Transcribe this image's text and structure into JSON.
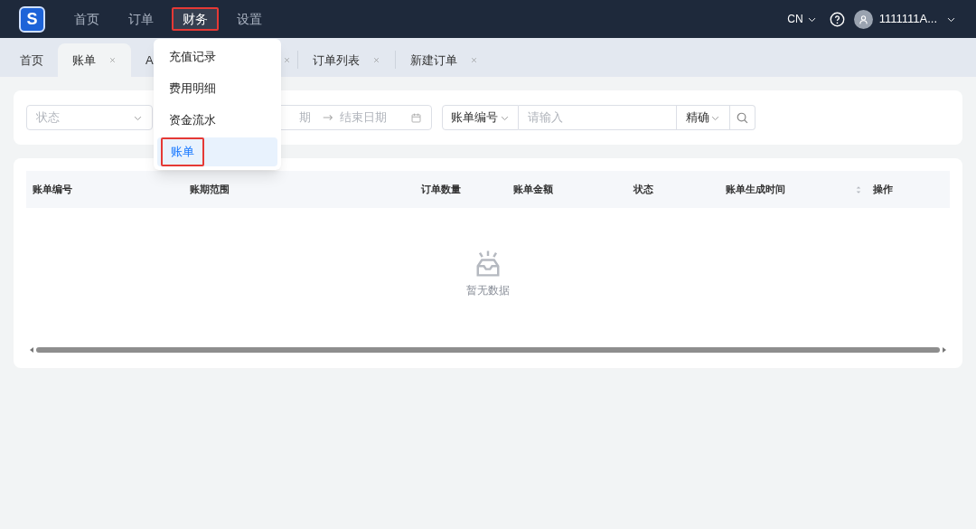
{
  "top_nav": {
    "logo": "S",
    "items": [
      {
        "label": "首页",
        "selected": false,
        "highlighted": false
      },
      {
        "label": "订单",
        "selected": false,
        "highlighted": false
      },
      {
        "label": "财务",
        "selected": true,
        "highlighted": true
      },
      {
        "label": "设置",
        "selected": false,
        "highlighted": false
      }
    ],
    "language": "CN",
    "user": "1111111A..."
  },
  "tabs": [
    {
      "label": "首页",
      "selected": false,
      "closable": false
    },
    {
      "label": "账单",
      "selected": true,
      "closable": true
    },
    {
      "label": "A",
      "selected": false,
      "closable": true
    },
    {
      "label": "订单列表",
      "selected": false,
      "closable": true
    },
    {
      "label": "新建订单",
      "selected": false,
      "closable": true
    }
  ],
  "dropdown_menu": {
    "items": [
      {
        "label": "充值记录",
        "selected": false,
        "highlighted": false
      },
      {
        "label": "费用明细",
        "selected": false,
        "highlighted": false
      },
      {
        "label": "资金流水",
        "selected": false,
        "highlighted": false
      },
      {
        "label": "账单",
        "selected": true,
        "highlighted": true
      }
    ]
  },
  "filters": {
    "status_placeholder": "状态",
    "start_date_placeholder": "期",
    "end_date_placeholder": "结束日期",
    "field_select": "账单编号",
    "search_placeholder": "请输入",
    "match_select": "精确"
  },
  "table": {
    "columns": [
      {
        "label": "账单编号",
        "sortable": false
      },
      {
        "label": "账期范围",
        "sortable": false
      },
      {
        "label": "订单数量",
        "sortable": false
      },
      {
        "label": "账单金额",
        "sortable": false
      },
      {
        "label": "状态",
        "sortable": false
      },
      {
        "label": "账单生成时间",
        "sortable": true
      },
      {
        "label": "操作",
        "sortable": false
      }
    ],
    "empty_text": "暂无数据"
  }
}
